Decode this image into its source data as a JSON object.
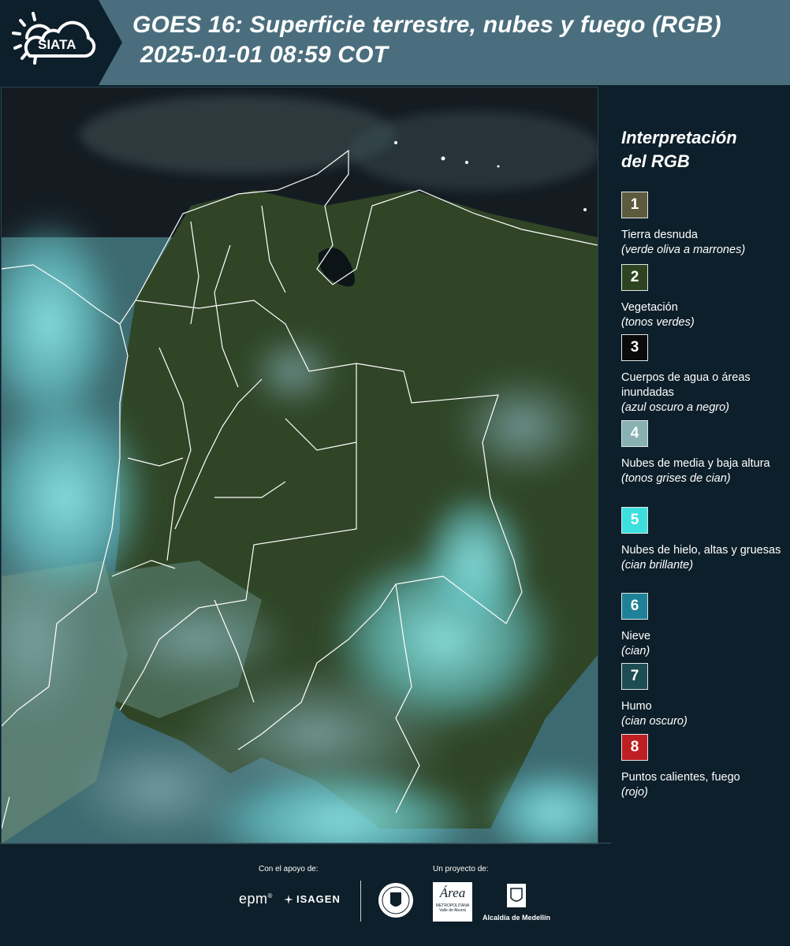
{
  "header": {
    "logo_text": "SIATA",
    "title_line1": "GOES 16: Superficie terrestre, nubes y fuego (RGB)",
    "title_line2": "2025-01-01 08:59 COT"
  },
  "legend": {
    "title_line1": "Interpretación",
    "title_line2": "del RGB",
    "items": [
      {
        "number": "1",
        "color": "#5d5b3e",
        "label": "Tierra desnuda",
        "sub": "(verde oliva a marrones)"
      },
      {
        "number": "2",
        "color": "#2e4420",
        "label": "Vegetación",
        "sub": "(tonos verdes)"
      },
      {
        "number": "3",
        "color": "#0a0a0a",
        "label": "Cuerpos de agua o áreas inundadas",
        "sub": "(azul oscuro a negro)"
      },
      {
        "number": "4",
        "color": "#89b1b2",
        "label": "Nubes de media y baja altura",
        "sub": "(tonos grises de cian)"
      },
      {
        "number": "5",
        "color": "#3ee0de",
        "label": "Nubes de hielo, altas y gruesas",
        "sub": "(cian brillante)"
      },
      {
        "number": "6",
        "color": "#1f8197",
        "label": "Nieve",
        "sub": "(cian)"
      },
      {
        "number": "7",
        "color": "#1d4d52",
        "label": "Humo",
        "sub": "(cian oscuro)"
      },
      {
        "number": "8",
        "color": "#bf1f22",
        "label": "Puntos calientes, fuego",
        "sub": "(rojo)"
      }
    ]
  },
  "footer": {
    "support_label": "Con el apoyo de:",
    "project_label": "Un proyecto de:",
    "partner_epm": "epm",
    "partner_isagen": "ISAGEN",
    "partner_area": "Área",
    "partner_area_sub": "METROPOLITANA",
    "partner_area_sub2": "Valle de Aburrá",
    "partner_alcaldia": "Alcaldía de Medellín"
  }
}
